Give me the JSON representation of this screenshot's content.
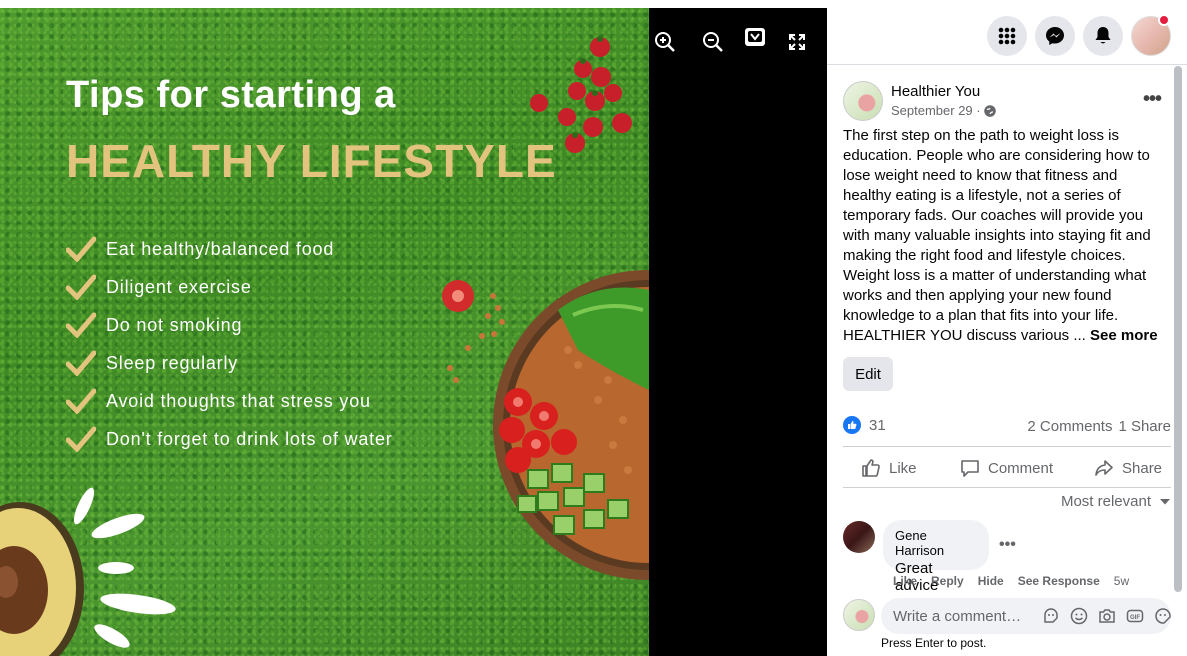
{
  "photo": {
    "title_line1": "Tips for starting a",
    "title_line2": "HEALTHY LIFESTYLE",
    "tips": [
      "Eat healthy/balanced food",
      "Diligent exercise",
      "Do not smoking",
      "Sleep regularly",
      "Avoid thoughts that stress you",
      "Don't forget to drink lots of water"
    ],
    "colors": {
      "grass": "#4a9230",
      "gold": "#e2c47f",
      "background": "#000000"
    }
  },
  "viewer_controls": [
    "zoom-in-icon",
    "zoom-out-icon",
    "tag-icon",
    "fullscreen-icon"
  ],
  "header_icons": [
    "menu-grid-icon",
    "messenger-icon",
    "notifications-icon",
    "profile-avatar"
  ],
  "post": {
    "page_name": "Healthier You",
    "date": "September 29 ·",
    "text": "The first step on the path to weight loss is education. People who are considering how to lose weight need to know that fitness and healthy eating is a lifestyle, not a series of temporary fads. Our coaches will provide you with many valuable insights into staying fit and making the right food and lifestyle choices. Weight loss is a matter of understanding what works and then applying your new found knowledge to a plan that fits into your life. HEALTHIER YOU discuss various ...",
    "see_more": "See more",
    "edit_label": "Edit",
    "likes_count": "31",
    "comments_count": "2 Comments",
    "shares_count": "1 Share",
    "actions": {
      "like": "Like",
      "comment": "Comment",
      "share": "Share"
    },
    "sort_label": "Most relevant"
  },
  "comment": {
    "author": "Gene Harrison",
    "text": "Great advice",
    "actions": [
      "Like",
      "Reply",
      "Hide",
      "See Response"
    ],
    "time": "5w"
  },
  "composer": {
    "placeholder": "Write a comment…",
    "hint": "Press Enter to post."
  },
  "accent_color": "#1877f2"
}
